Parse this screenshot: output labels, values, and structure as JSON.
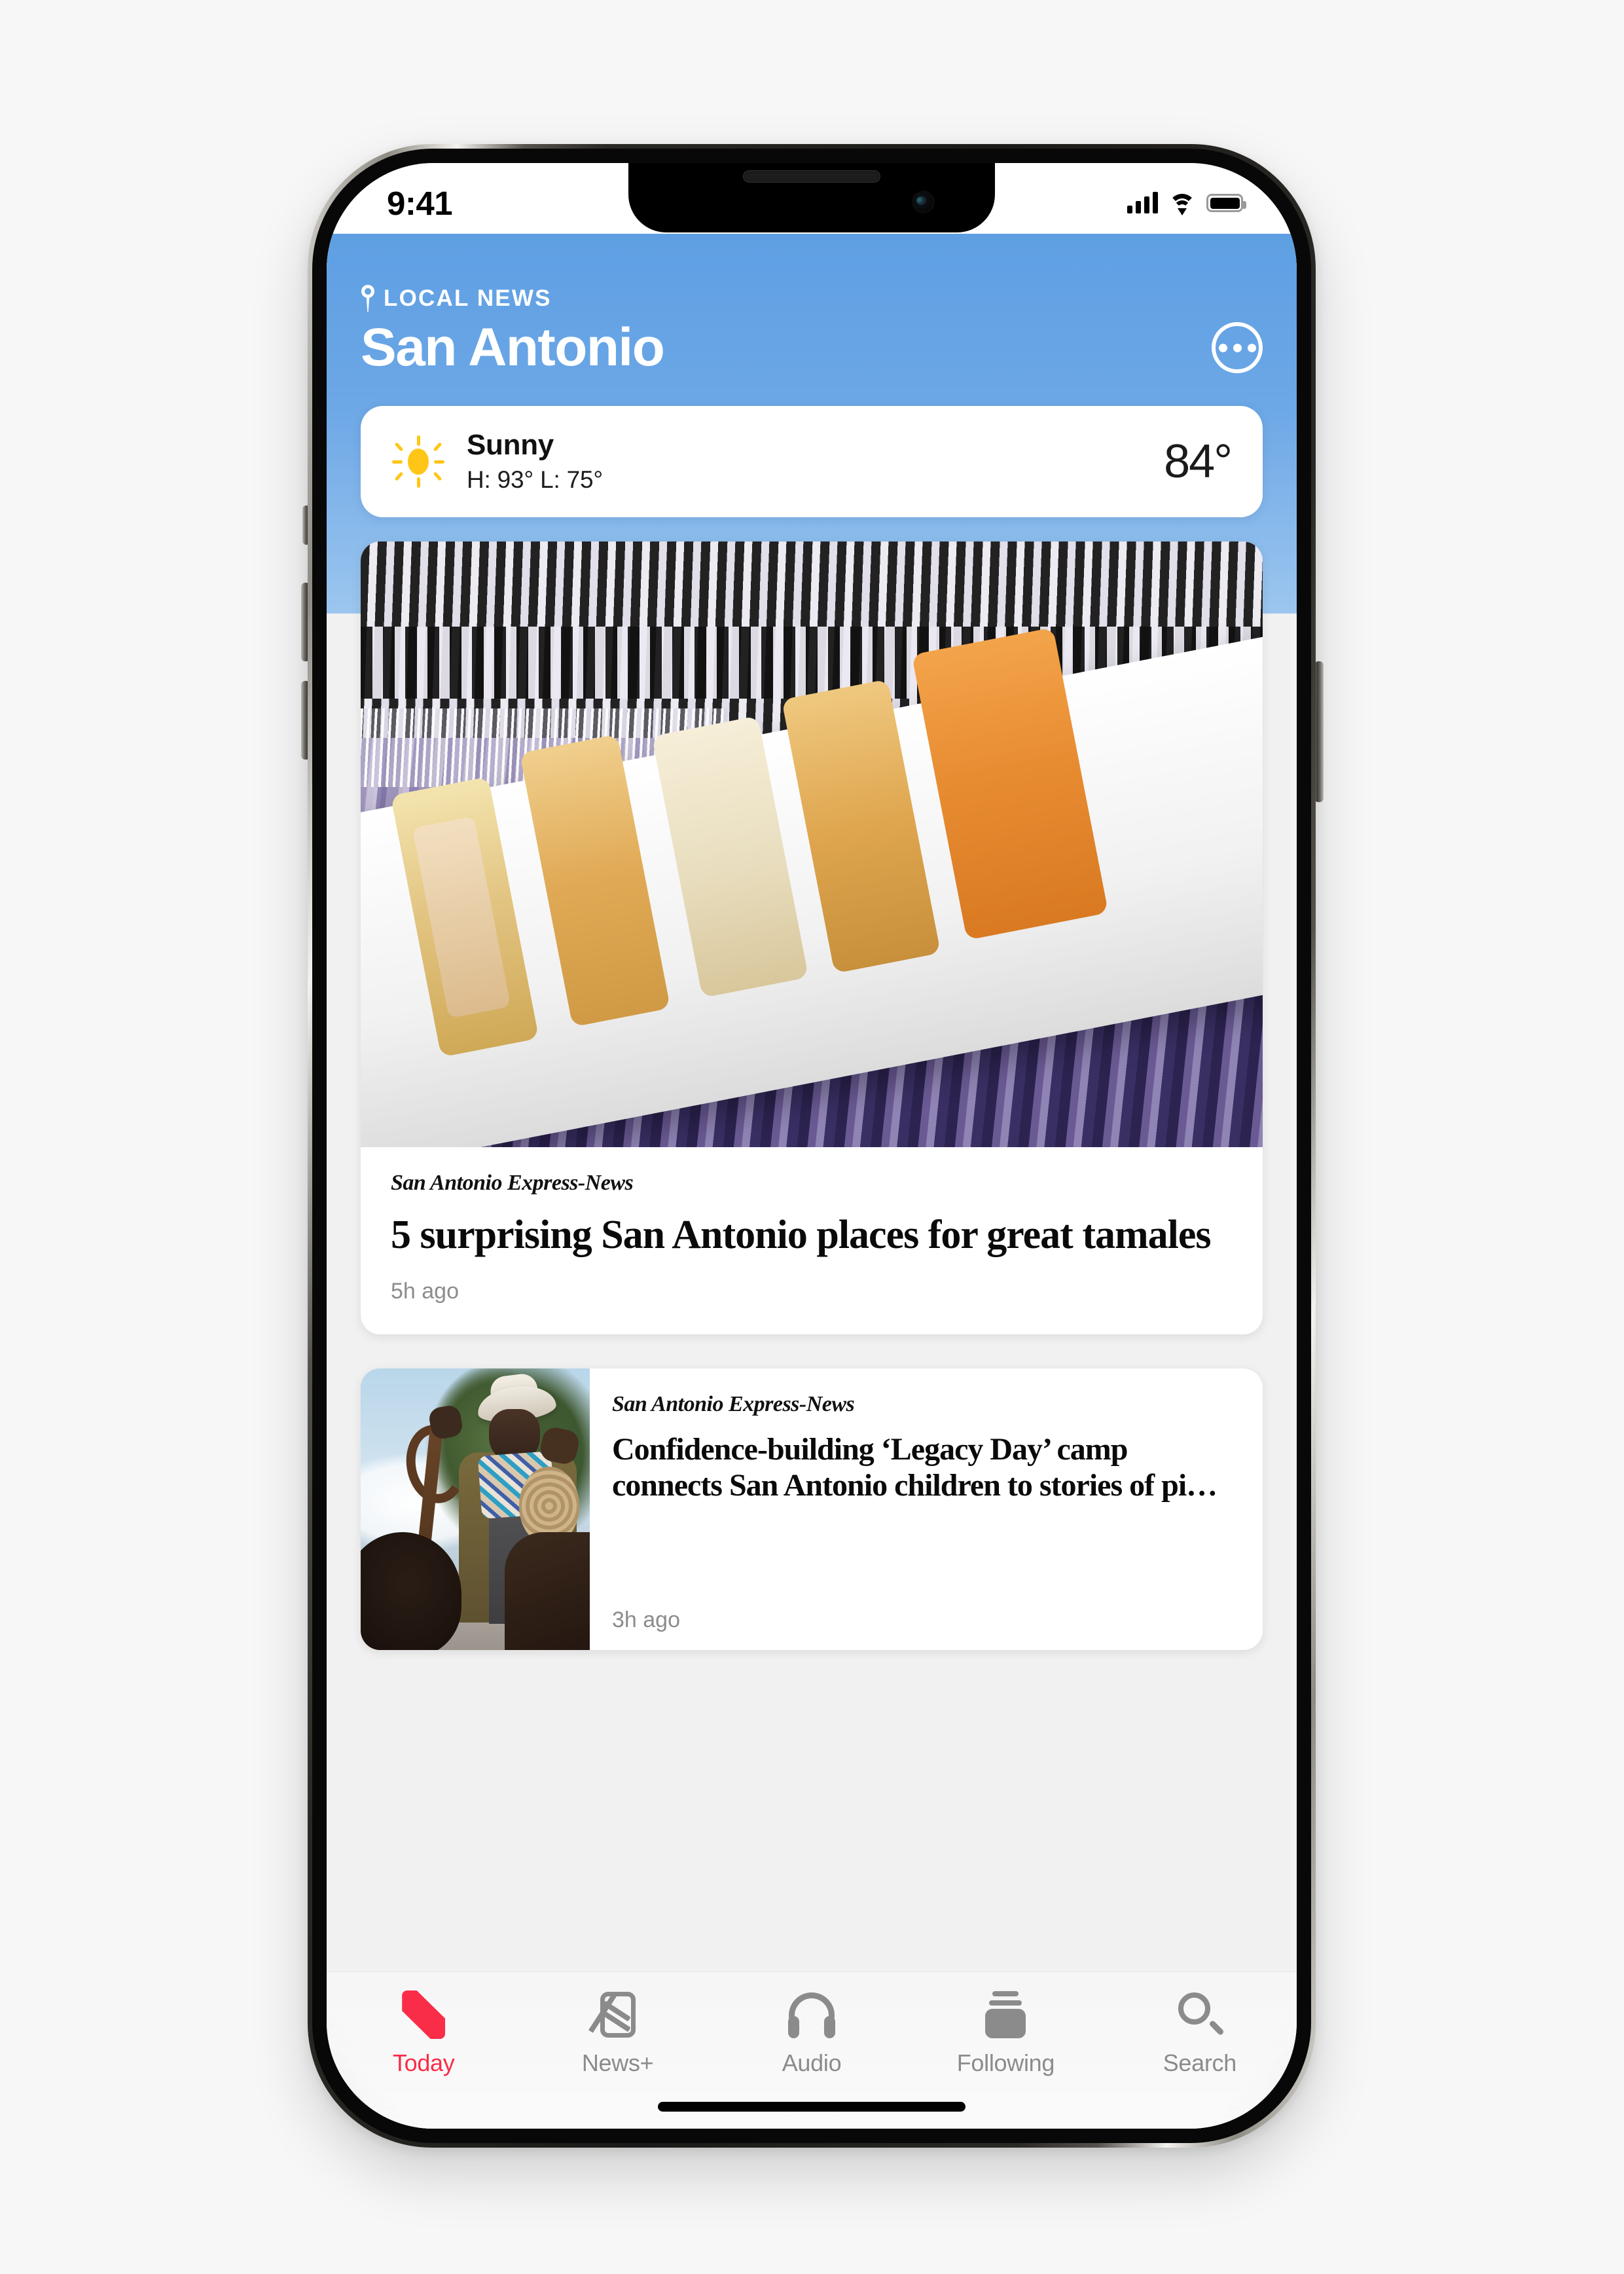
{
  "status_bar": {
    "time": "9:41",
    "cellular_icon": "signal-bars-icon",
    "wifi_icon": "wifi-icon",
    "battery_icon": "battery-full-icon"
  },
  "header": {
    "pin_icon": "location-pin-icon",
    "kicker": "LOCAL NEWS",
    "title": "San Antonio",
    "more_icon": "ellipsis-circle-icon"
  },
  "weather": {
    "icon": "sun-icon",
    "condition": "Sunny",
    "high_low": "H: 93°  L: 75°",
    "temperature": "84°"
  },
  "feed": {
    "articles": [
      {
        "image_alt": "tamales-on-white-plate-photo",
        "source": "San Antonio Express-News",
        "headline": "5 surprising San Antonio places for great tamales",
        "timestamp": "5h ago"
      },
      {
        "image_alt": "cowboy-with-child-photo",
        "source": "San Antonio Express-News",
        "headline": "Confidence-building ‘Legacy Day’ camp connects San Antonio children to stories of pi…",
        "timestamp": "3h ago"
      }
    ]
  },
  "tab_bar": {
    "items": [
      {
        "label": "Today",
        "icon": "apple-news-logo-icon",
        "active": true
      },
      {
        "label": "News+",
        "icon": "news-plus-icon",
        "active": false
      },
      {
        "label": "Audio",
        "icon": "headphones-icon",
        "active": false
      },
      {
        "label": "Following",
        "icon": "stacked-cards-icon",
        "active": false
      },
      {
        "label": "Search",
        "icon": "magnifier-icon",
        "active": false
      }
    ]
  },
  "colors": {
    "accent": "#FA2D48",
    "header_blue_top": "#5E9FE3",
    "header_blue_bottom": "#9CC6EF",
    "sun_yellow": "#FFC617",
    "inactive_gray": "#8B8B8B",
    "feed_background": "#F1F1F1"
  }
}
